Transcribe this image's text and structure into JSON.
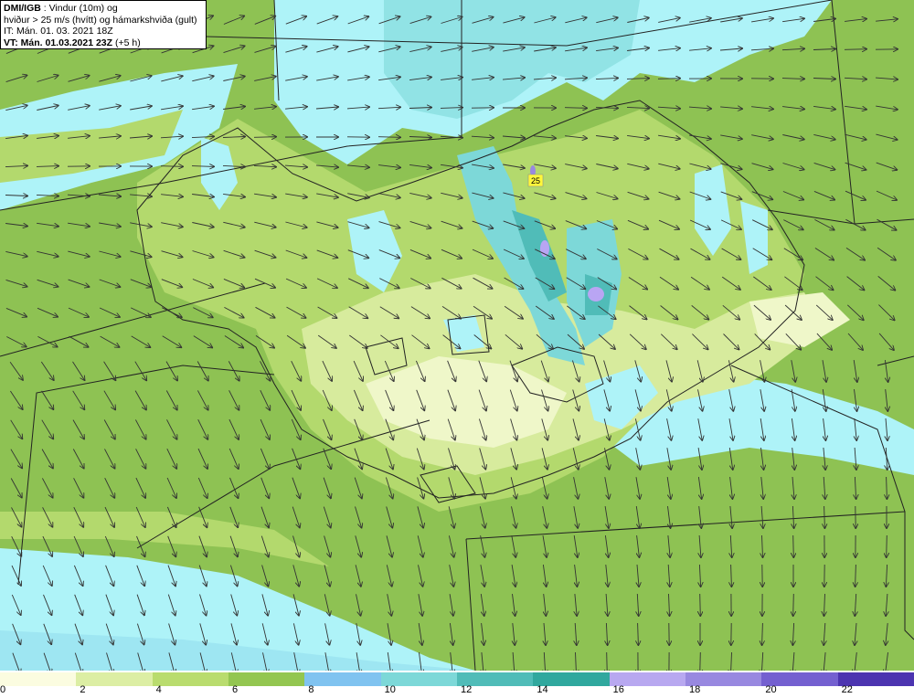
{
  "info": {
    "line1_bold": "DMI/IGB",
    "line1_rest": " : Vindur (10m) og",
    "line2": "hviður > 25 m/s (hvítt) og hámarkshviða (gult)",
    "line3": "IT: Mán. 01. 03. 2021 18Z",
    "line4_bold": "VT: Mán. 01.03.2021 23Z",
    "line4_rest": " (+5 h)"
  },
  "gust_label": "25",
  "legend": {
    "colors": [
      "#fbfce0",
      "#dceea4",
      "#b9dc6e",
      "#93c650",
      "#80c3f0",
      "#7dd8d8",
      "#50bcb8",
      "#30a89e",
      "#b8a8f0",
      "#9888e0",
      "#7460d0",
      "#4c34b0"
    ],
    "ticks": [
      "0",
      "2",
      "4",
      "6",
      "8",
      "10",
      "12",
      "14",
      "16",
      "18",
      "20",
      "22"
    ]
  },
  "palette": {
    "sea_cyan": "#aef3f8",
    "calm_green": "#8ec253",
    "mid_green": "#b3d96d",
    "light_green": "#d7eb9d",
    "pale": "#eff7c9",
    "teal": "#5cc8be",
    "purple": "#b9a5f3"
  }
}
